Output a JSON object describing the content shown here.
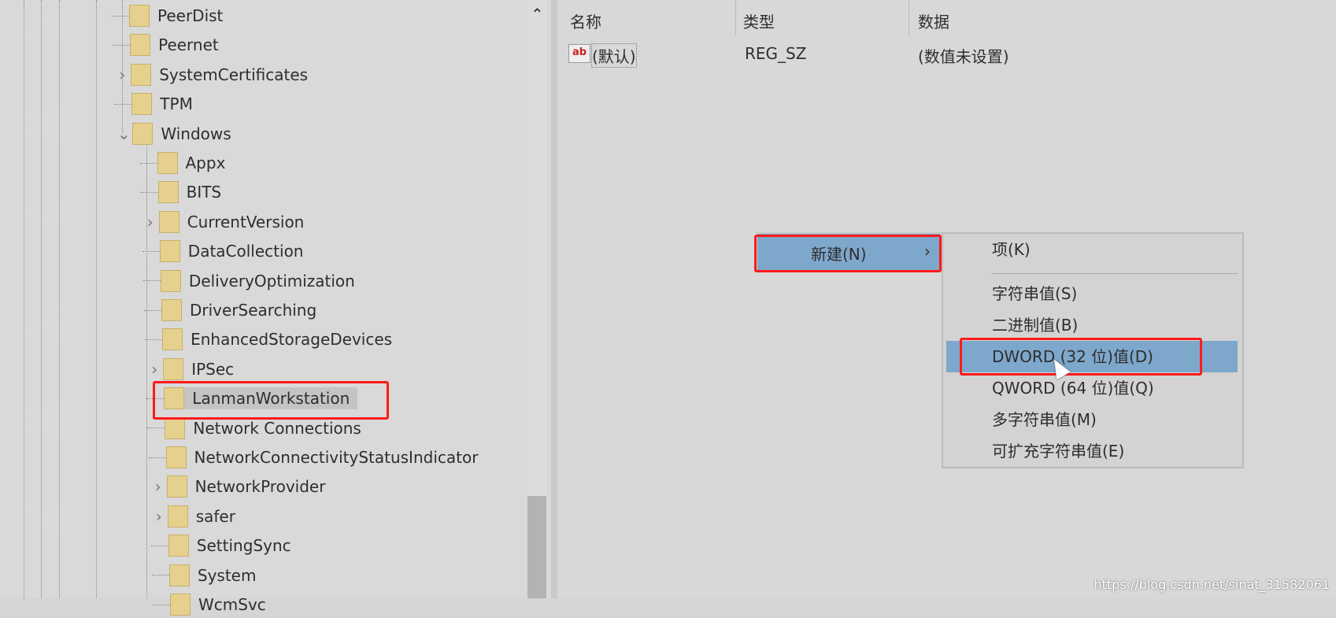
{
  "tree": {
    "items": [
      {
        "label": "PeerDist",
        "level": 1,
        "expander": "none"
      },
      {
        "label": "Peernet",
        "level": 1,
        "expander": "none"
      },
      {
        "label": "SystemCertificates",
        "level": 1,
        "expander": "collapsed"
      },
      {
        "label": "TPM",
        "level": 1,
        "expander": "none"
      },
      {
        "label": "Windows",
        "level": 1,
        "expander": "expanded"
      },
      {
        "label": "Appx",
        "level": 2,
        "expander": "none"
      },
      {
        "label": "BITS",
        "level": 2,
        "expander": "none"
      },
      {
        "label": "CurrentVersion",
        "level": 2,
        "expander": "collapsed"
      },
      {
        "label": "DataCollection",
        "level": 2,
        "expander": "none"
      },
      {
        "label": "DeliveryOptimization",
        "level": 2,
        "expander": "none"
      },
      {
        "label": "DriverSearching",
        "level": 2,
        "expander": "none"
      },
      {
        "label": "EnhancedStorageDevices",
        "level": 2,
        "expander": "none"
      },
      {
        "label": "IPSec",
        "level": 2,
        "expander": "collapsed"
      },
      {
        "label": "LanmanWorkstation",
        "level": 2,
        "expander": "none",
        "selected": true
      },
      {
        "label": "Network Connections",
        "level": 2,
        "expander": "none"
      },
      {
        "label": "NetworkConnectivityStatusIndicator",
        "level": 2,
        "expander": "none"
      },
      {
        "label": "NetworkProvider",
        "level": 2,
        "expander": "collapsed"
      },
      {
        "label": "safer",
        "level": 2,
        "expander": "collapsed"
      },
      {
        "label": "SettingSync",
        "level": 2,
        "expander": "none"
      },
      {
        "label": "System",
        "level": 2,
        "expander": "none"
      },
      {
        "label": "WcmSvc",
        "level": 2,
        "expander": "none"
      }
    ]
  },
  "values_pane": {
    "columns": [
      "名称",
      "类型",
      "数据"
    ],
    "rows": [
      {
        "name": "(默认)",
        "type": "REG_SZ",
        "data": "(数值未设置)",
        "icon": "ab"
      }
    ]
  },
  "context_menu": {
    "new_label": "新建(N)",
    "arrow": "›",
    "submenu": [
      "项(K)",
      "字符串值(S)",
      "二进制值(B)",
      "DWORD (32 位)值(D)",
      "QWORD (64 位)值(Q)",
      "多字符串值(M)",
      "可扩充字符串值(E)"
    ],
    "highlighted": "DWORD (32 位)值(D)"
  },
  "colors": {
    "highlight": "#7ea7cc",
    "annotation_red": "#ff1a1a",
    "folder": "#e6d08e"
  },
  "watermark": "https://blog.csdn.net/sinat_31582061"
}
